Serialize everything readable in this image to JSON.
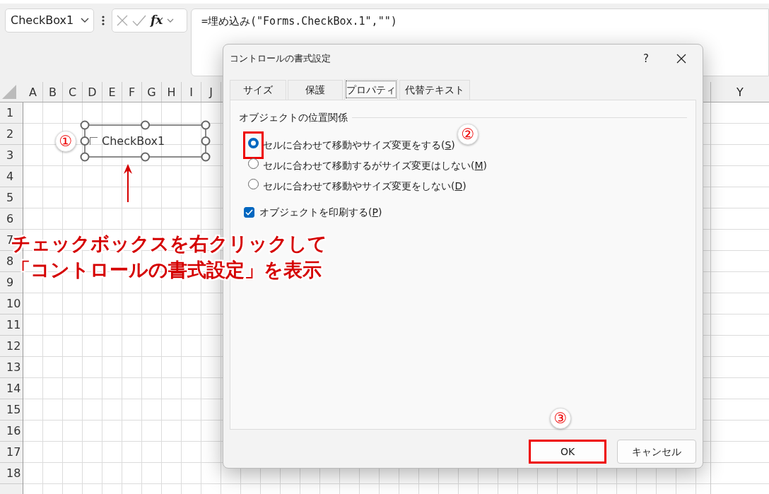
{
  "name_box": {
    "value": "CheckBox1"
  },
  "formula_bar": {
    "fx_label": "fx",
    "value": "=埋め込み(\"Forms.CheckBox.1\",\"\")"
  },
  "sheet": {
    "columns": [
      "A",
      "B",
      "C",
      "D",
      "E",
      "F",
      "G",
      "H",
      "I",
      "J"
    ],
    "right_column": "Y",
    "rows": [
      "1",
      "2",
      "3",
      "4",
      "5",
      "6",
      "7",
      "8",
      "9",
      "10",
      "11",
      "12",
      "13",
      "14",
      "15",
      "16",
      "17",
      "18"
    ],
    "checkbox_control": {
      "label": "CheckBox1",
      "checked": false,
      "selected": true
    }
  },
  "dialog": {
    "title": "コントロールの書式設定",
    "help": "?",
    "tabs": [
      {
        "label": "サイズ",
        "selected": false
      },
      {
        "label": "保護",
        "selected": false
      },
      {
        "label": "プロパティ",
        "selected": true
      },
      {
        "label": "代替テキスト",
        "selected": false
      }
    ],
    "group_label": "オブジェクトの位置関係",
    "placement_options": [
      {
        "label": "セルに合わせて移動やサイズ変更をする(S)",
        "selected": true,
        "highlighted": true
      },
      {
        "label": "セルに合わせて移動するがサイズ変更はしない(M)",
        "selected": false,
        "highlighted": false
      },
      {
        "label": "セルに合わせて移動やサイズ変更をしない(D)",
        "selected": false,
        "highlighted": false
      }
    ],
    "print_object": {
      "label": "オブジェクトを印刷する(P)",
      "checked": true
    },
    "buttons": [
      {
        "label": "OK",
        "highlighted": true
      },
      {
        "label": "キャンセル",
        "highlighted": false
      }
    ]
  },
  "annotations": {
    "steps": [
      "①",
      "②",
      "③"
    ],
    "callout": {
      "lines": [
        "チェックボックスを右クリックして",
        "「コントロールの書式設定」を表示"
      ]
    }
  }
}
